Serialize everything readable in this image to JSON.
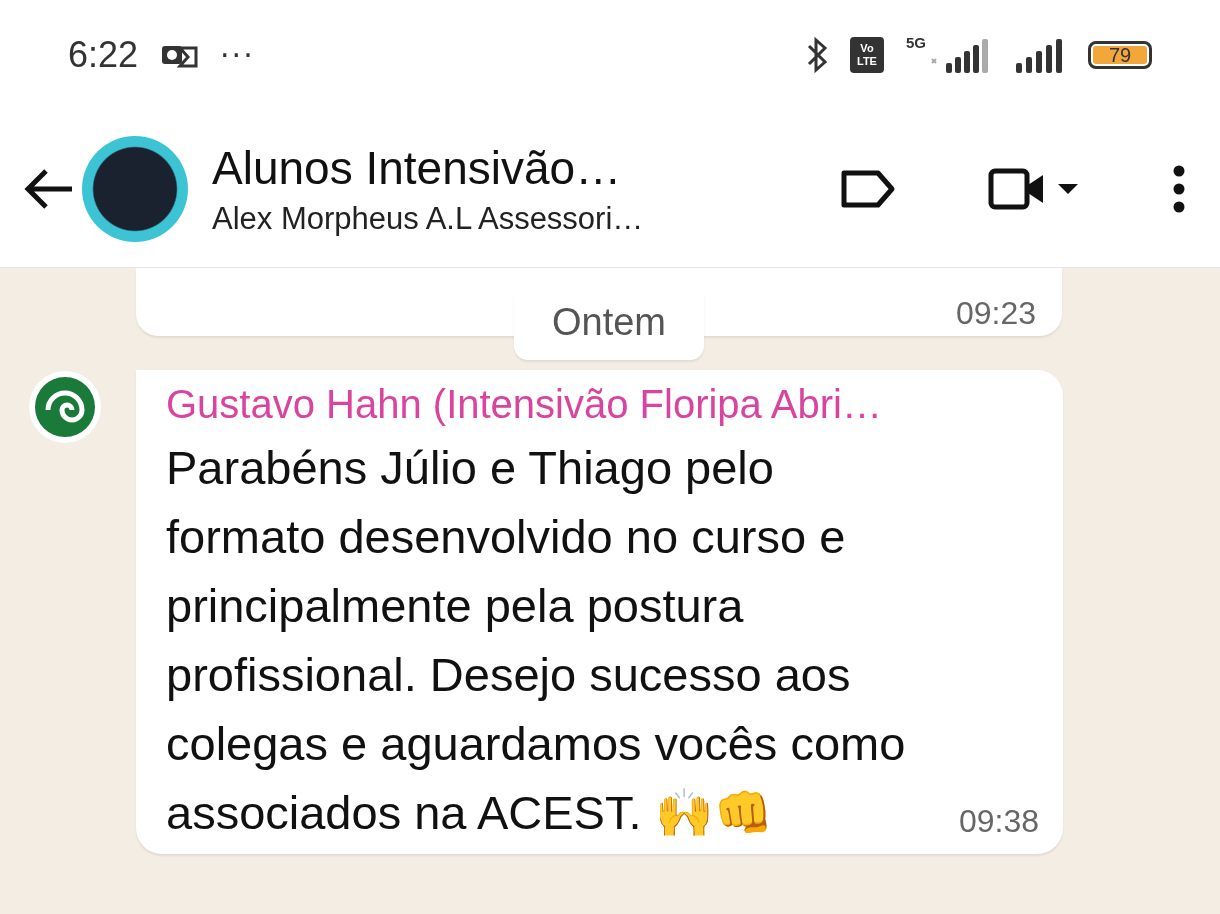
{
  "status_bar": {
    "time": "6:22",
    "more": "···",
    "volte": [
      "Vo",
      "LTE"
    ],
    "network": "5G",
    "battery": "79"
  },
  "header": {
    "title": "Alunos Intensivão…",
    "subtitle": "Alex Morpheus A.L Assessori…"
  },
  "previous_message": {
    "time": "09:23"
  },
  "date_chip": "Ontem",
  "message": {
    "sender": "Gustavo Hahn (Intensivão Floripa Abri…",
    "color": "#d9449e",
    "text": "Parabéns Júlio e Thiago pelo formato desenvolvido no curso e principalmente pela postura profissional. Desejo sucesso aos colegas e aguardamos vocês como associados na ACEST. 🙌👊",
    "time": "09:38"
  }
}
